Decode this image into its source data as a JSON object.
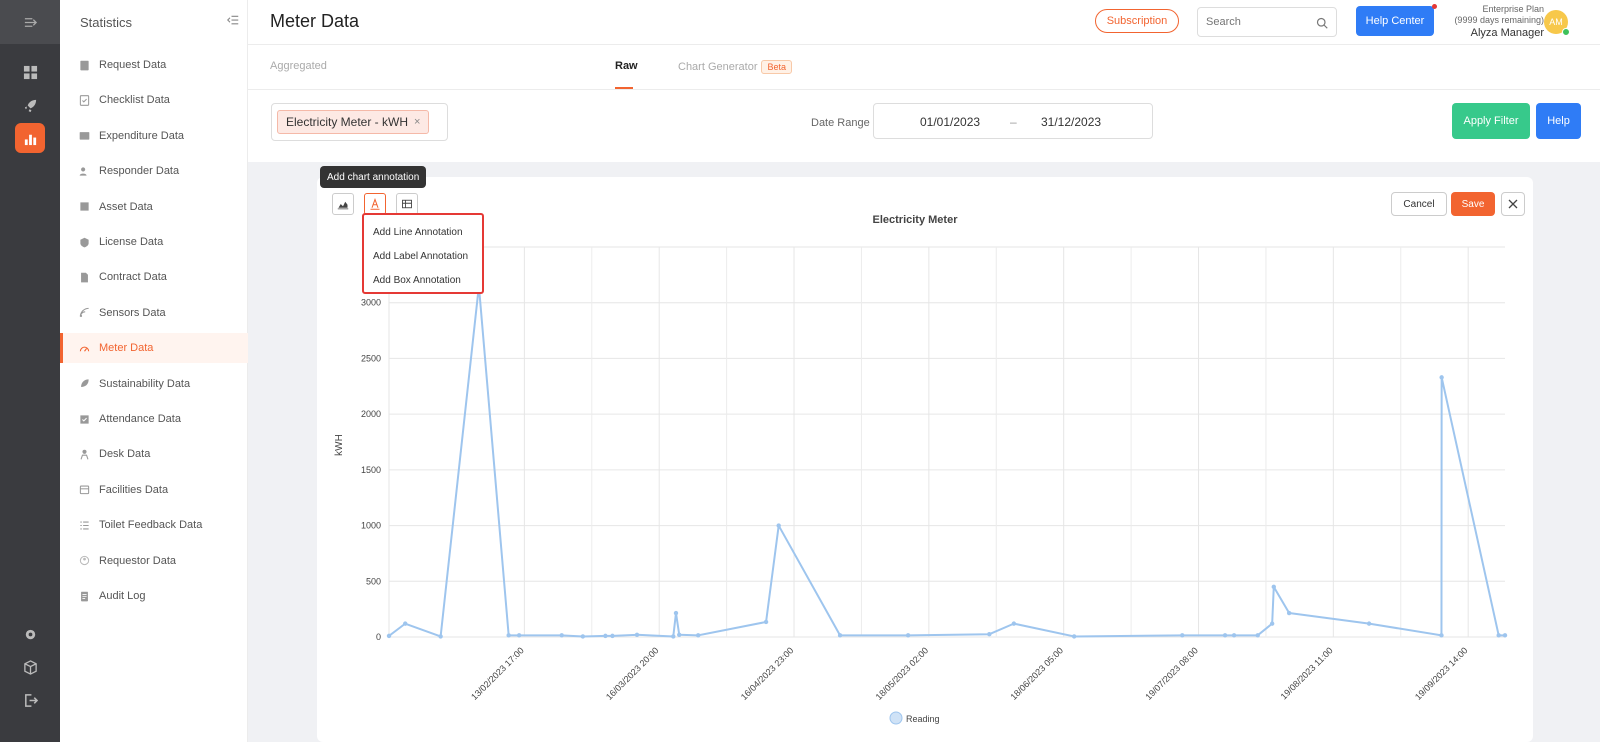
{
  "rail": {
    "icons": [
      "collapse-menu-icon",
      "dashboard-icon",
      "rocket-icon",
      "statistics-icon",
      "gear-icon",
      "box-icon",
      "logout-icon"
    ]
  },
  "sidebar": {
    "title": "Statistics",
    "items": [
      {
        "label": "Request Data",
        "icon": "request-icon"
      },
      {
        "label": "Checklist Data",
        "icon": "checklist-icon"
      },
      {
        "label": "Expenditure Data",
        "icon": "expenditure-icon"
      },
      {
        "label": "Responder Data",
        "icon": "responder-icon"
      },
      {
        "label": "Asset Data",
        "icon": "asset-icon"
      },
      {
        "label": "License Data",
        "icon": "license-icon"
      },
      {
        "label": "Contract Data",
        "icon": "contract-icon"
      },
      {
        "label": "Sensors Data",
        "icon": "sensors-icon"
      },
      {
        "label": "Meter Data",
        "icon": "meter-icon",
        "active": true
      },
      {
        "label": "Sustainability Data",
        "icon": "sustainability-icon"
      },
      {
        "label": "Attendance Data",
        "icon": "attendance-icon"
      },
      {
        "label": "Desk Data",
        "icon": "desk-icon"
      },
      {
        "label": "Facilities Data",
        "icon": "facilities-icon"
      },
      {
        "label": "Toilet Feedback Data",
        "icon": "toilet-feedback-icon"
      },
      {
        "label": "Requestor Data",
        "icon": "requestor-icon"
      },
      {
        "label": "Audit Log",
        "icon": "audit-log-icon"
      }
    ]
  },
  "header": {
    "title": "Meter Data",
    "subscription_label": "Subscription",
    "search_placeholder": "Search",
    "help_center_label": "Help Center",
    "plan_name": "Enterprise Plan",
    "plan_remaining": "(9999 days remaining)",
    "user_name": "Alyza Manager",
    "avatar_initials": "AM"
  },
  "tabs": {
    "aggregated": "Aggregated",
    "raw": "Raw",
    "chart_generator": "Chart Generator",
    "beta": "Beta"
  },
  "filter": {
    "meter_chip": "Electricity Meter - kWH",
    "date_range_label": "Date Range",
    "date_from": "01/01/2023",
    "date_sep": "–",
    "date_to": "31/12/2023",
    "apply_label": "Apply Filter",
    "help_label": "Help"
  },
  "toolbar": {
    "tooltip": "Add chart annotation",
    "menu": [
      "Add Line Annotation",
      "Add Label Annotation",
      "Add Box Annotation"
    ],
    "cancel_label": "Cancel",
    "save_label": "Save"
  },
  "colors": {
    "accent": "#f26430",
    "line": "#9ec5ee",
    "apply": "#37c98b",
    "primary": "#2f7cf6"
  },
  "chart_data": {
    "type": "line",
    "title": "Electricity Meter",
    "ylabel": "kWH",
    "xlabel": "",
    "ylim": [
      0,
      3500
    ],
    "yticks": [
      0,
      500,
      1000,
      1500,
      2000,
      2500,
      3000
    ],
    "xticks": [
      "13/02/2023 17:00",
      "16/03/2023 20:00",
      "16/04/2023 23:00",
      "18/05/2023 02:00",
      "18/06/2023 05:00",
      "19/07/2023 08:00",
      "19/08/2023 11:00",
      "19/09/2023 14:00"
    ],
    "grid": true,
    "legend_position": "bottom",
    "series": [
      {
        "name": "Reading",
        "points": [
          [
            "2023-01-13 11:00",
            10
          ],
          [
            "2023-01-17 05:00",
            120
          ],
          [
            "2023-01-25 09:00",
            5
          ],
          [
            "2023-02-03 05:00",
            3150
          ],
          [
            "2023-02-10 02:00",
            15
          ],
          [
            "2023-02-12 12:00",
            15
          ],
          [
            "2023-02-22 08:00",
            15
          ],
          [
            "2023-02-27 05:00",
            5
          ],
          [
            "2023-03-04 10:00",
            10
          ],
          [
            "2023-03-06 01:00",
            10
          ],
          [
            "2023-03-11 17:00",
            20
          ],
          [
            "2023-03-20 02:00",
            5
          ],
          [
            "2023-03-20 17:00",
            215
          ],
          [
            "2023-03-21 11:00",
            20
          ],
          [
            "2023-03-25 20:00",
            15
          ],
          [
            "2023-04-10 12:00",
            135
          ],
          [
            "2023-04-13 10:00",
            1000
          ],
          [
            "2023-04-27 14:00",
            15
          ],
          [
            "2023-05-13 07:00",
            15
          ],
          [
            "2023-06-01 01:00",
            25
          ],
          [
            "2023-06-06 17:00",
            120
          ],
          [
            "2023-06-20 15:00",
            5
          ],
          [
            "2023-07-15 14:00",
            15
          ],
          [
            "2023-07-25 11:00",
            15
          ],
          [
            "2023-07-27 13:00",
            15
          ],
          [
            "2023-08-02 00:00",
            15
          ],
          [
            "2023-08-05 08:00",
            120
          ],
          [
            "2023-08-05 17:00",
            450
          ],
          [
            "2023-08-09 06:00",
            215
          ],
          [
            "2023-08-27 17:00",
            120
          ],
          [
            "2023-09-13 10:00",
            15
          ],
          [
            "2023-09-13 11:00",
            2330
          ],
          [
            "2023-09-26 15:00",
            15
          ],
          [
            "2023-09-28 02:00",
            15
          ]
        ]
      }
    ]
  }
}
